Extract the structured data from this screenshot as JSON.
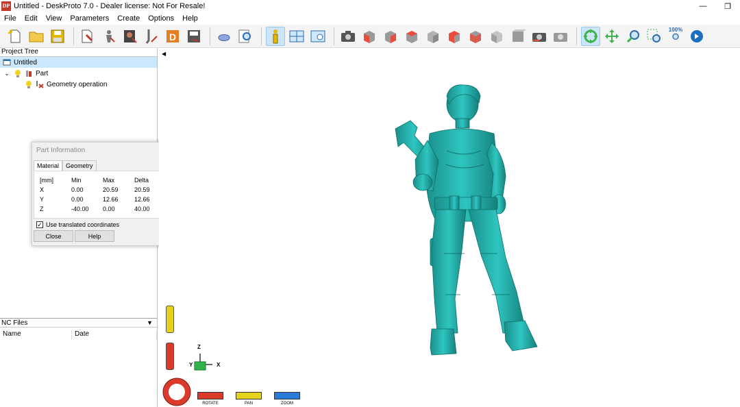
{
  "window": {
    "logo_text": "DP",
    "title": "Untitled - DeskProto 7.0 - Dealer license: Not For Resale!",
    "controls": [
      "—",
      "❐"
    ]
  },
  "menu": [
    "File",
    "Edit",
    "View",
    "Parameters",
    "Create",
    "Options",
    "Help"
  ],
  "toolbar": {
    "zoom_label": "100%",
    "buttons": [
      "new-file",
      "open-folder",
      "save",
      "import-part",
      "import-2",
      "cutter",
      "tool",
      "drill",
      "d-button",
      "export",
      "shape",
      "magnify",
      "info",
      "grid-view",
      "screen-view",
      "camera",
      "view-front",
      "view-back",
      "view-left",
      "view-right",
      "view-top",
      "view-bottom",
      "view-iso",
      "view-gray",
      "camera-2",
      "camera-3",
      "rotate",
      "pan",
      "zoom-in",
      "zoom-window",
      "zoom-100",
      "next"
    ]
  },
  "project_tree": {
    "header": "Project Tree",
    "items": [
      {
        "label": "Untitled",
        "level": 0,
        "selected": true
      },
      {
        "label": "Part",
        "level": 1
      },
      {
        "label": "Geometry operation",
        "level": 2
      }
    ]
  },
  "nc_files": {
    "header": "NC Files",
    "columns": [
      "Name",
      "Date"
    ]
  },
  "part_info": {
    "title": "Part Information",
    "tabs": [
      "Material",
      "Geometry"
    ],
    "active_tab": "Material",
    "table_header": [
      "[mm]",
      "Min",
      "Max",
      "Delta"
    ],
    "rows": [
      [
        "X",
        "0.00",
        "20.59",
        "20.59"
      ],
      [
        "Y",
        "0.00",
        "12.66",
        "12.66"
      ],
      [
        "Z",
        "-40.00",
        "0.00",
        "40.00"
      ]
    ],
    "checkbox_label": "Use translated coordinates",
    "checkbox_checked": true,
    "close_label": "Close",
    "help_label": "Help"
  },
  "viewport": {
    "model_color": "#28b4b0",
    "axes": {
      "z": "Z",
      "y": "Y",
      "x": "X"
    },
    "controls": [
      {
        "label": "ROTATE",
        "color": "#d93a2a"
      },
      {
        "label": "PAN",
        "color": "#e6d21a"
      },
      {
        "label": "ZOOM",
        "color": "#2a7bd9"
      }
    ]
  }
}
